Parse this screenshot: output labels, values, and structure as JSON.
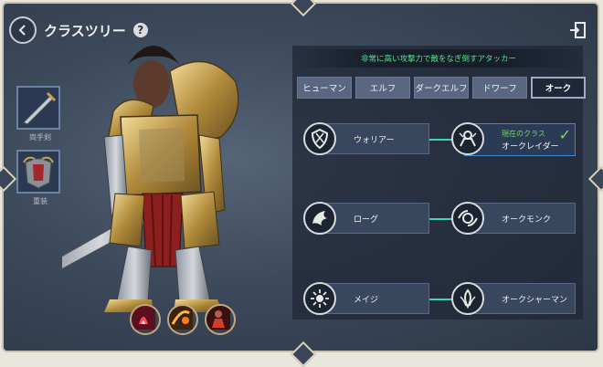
{
  "header": {
    "title": "クラスツリー",
    "help": "?",
    "back_icon": "back-arrow-icon",
    "exit_icon": "exit-door-icon"
  },
  "equipment": {
    "slots": [
      {
        "label": "両手剣",
        "icon": "sword-icon"
      },
      {
        "label": "重装",
        "icon": "heavy-armor-icon"
      }
    ]
  },
  "skills": [
    {
      "icon": "skill-fire-icon"
    },
    {
      "icon": "skill-slash-icon"
    },
    {
      "icon": "skill-rage-icon"
    }
  ],
  "description": "非常に高い攻撃力で敵をなぎ倒すアタッカー",
  "race_tabs": [
    "ヒューマン",
    "エルフ",
    "ダークエルフ",
    "ドワーフ",
    "オーク"
  ],
  "active_tab": "オーク",
  "class_tree": {
    "rows": [
      {
        "base": {
          "name": "ウォリアー",
          "icon": "warrior-shield-icon"
        },
        "advanced": {
          "name": "オークレイダー",
          "current_label": "現在のクラス",
          "icon": "orc-raider-icon",
          "current": true
        }
      },
      {
        "base": {
          "name": "ローグ",
          "icon": "rogue-wing-icon"
        },
        "advanced": {
          "name": "オークモンク",
          "icon": "orc-monk-icon",
          "current": false
        }
      },
      {
        "base": {
          "name": "メイジ",
          "icon": "mage-sun-icon"
        },
        "advanced": {
          "name": "オークシャーマン",
          "icon": "orc-shaman-icon",
          "current": false
        }
      }
    ]
  },
  "colors": {
    "accent_green": "#58e38c",
    "connector": "#3fd4b4",
    "current_border": "#3c8bd6",
    "check": "#7ee04a"
  }
}
